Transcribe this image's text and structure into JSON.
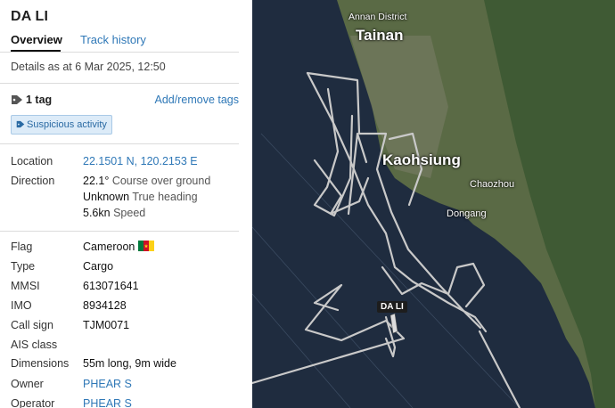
{
  "vessel": {
    "name": "DA LI"
  },
  "tabs": [
    {
      "label": "Overview",
      "active": true
    },
    {
      "label": "Track history",
      "active": false
    }
  ],
  "details_as_at": "Details as at 6 Mar 2025, 12:50",
  "tags": {
    "count_label": "1 tag",
    "manage_label": "Add/remove tags",
    "chip_label": "Suspicious activity"
  },
  "position": {
    "location_label": "Location",
    "location_value": "22.1501 N, 120.2153 E",
    "direction_label": "Direction",
    "course_value": "22.1°",
    "course_note": "Course over ground",
    "heading_value": "Unknown",
    "heading_note": "True heading",
    "speed_value": "5.6kn",
    "speed_note": "Speed"
  },
  "particulars": [
    {
      "label": "Flag",
      "value": "Cameroon",
      "has_flag": true
    },
    {
      "label": "Type",
      "value": "Cargo"
    },
    {
      "label": "MMSI",
      "value": "613071641"
    },
    {
      "label": "IMO",
      "value": "8934128"
    },
    {
      "label": "Call sign",
      "value": "TJM0071"
    },
    {
      "label": "AIS class",
      "value": ""
    },
    {
      "label": "Dimensions",
      "value": "55m long, 9m wide"
    },
    {
      "label": "Owner",
      "value": "PHEAR S",
      "link": true
    },
    {
      "label": "Operator",
      "value": "PHEAR S",
      "link": true
    }
  ],
  "map": {
    "labels": {
      "annan": "Annan District",
      "tainan": "Tainan",
      "kaohsiung": "Kaohsiung",
      "chaozhou": "Chaozhou",
      "dongang": "Dongang"
    },
    "vessel_label": "DA LI"
  },
  "colors": {
    "link": "#2f78b7",
    "chip_bg": "#dcebf8",
    "chip_text": "#2a6aa3",
    "sea": "#1f2c3f",
    "track": "#c9c9c9",
    "flag_green": "#007a3d",
    "flag_red": "#ce1126",
    "flag_yellow": "#fcd116"
  }
}
